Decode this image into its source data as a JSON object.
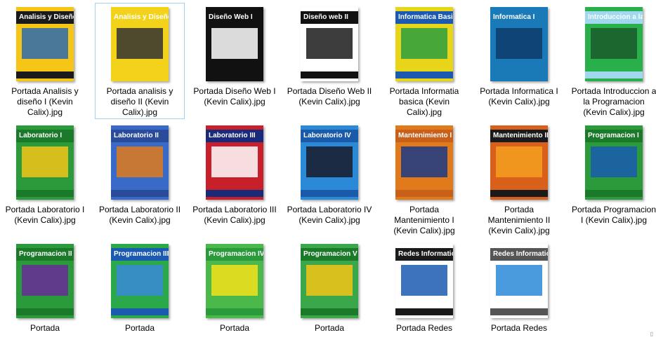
{
  "files": [
    {
      "label": "Portada Analisis y diseño I (Kevin Calix).jpg",
      "cover": "Analisis y Diseño I",
      "bg": "#f5c518",
      "band": "#1a1a1a",
      "accent": "#2a6ab0",
      "selected": false
    },
    {
      "label": "Portada analisis y diseño II (Kevin Calix).jpg",
      "cover": "Analisis y Diseño II",
      "bg": "#f2d21a",
      "band": "#f2d21a",
      "accent": "#333333",
      "selected": true
    },
    {
      "label": "Portada Diseño Web I (Kevin Calix).jpg",
      "cover": "Diseño Web I",
      "bg": "#111111",
      "band": "#111111",
      "accent": "#ffffff",
      "selected": false
    },
    {
      "label": "Portada Diseño Web II (Kevin Calix).jpg",
      "cover": "Diseño web II",
      "bg": "#ffffff",
      "band": "#111111",
      "accent": "#1a1a1a",
      "selected": false
    },
    {
      "label": "Portada Informatia basica (Kevin Calix).jpg",
      "cover": "Informatica Basica",
      "bg": "#e8d51a",
      "band": "#1a5ab0",
      "accent": "#2aa040",
      "selected": false
    },
    {
      "label": "Portada Informatica I (Kevin Calix).jpg",
      "cover": "Informatica I",
      "bg": "#1a7ab8",
      "band": "#1a7ab8",
      "accent": "#0d3c6a",
      "selected": false
    },
    {
      "label": "Portada Introduccion a la Programacion (Kevin Calix).jpg",
      "cover": "Introduccion a la Programacion",
      "bg": "#2ab04a",
      "band": "#9fd8ef",
      "accent": "#1a5a2a",
      "selected": false
    },
    {
      "label": "Portada Laboratorio I (Kevin Calix).jpg",
      "cover": "Laboratorio I",
      "bg": "#2a9a3a",
      "band": "#1a7a2a",
      "accent": "#f5c518",
      "selected": false
    },
    {
      "label": "Portada Laboratorio II (Kevin Calix).jpg",
      "cover": "Laboratorio II",
      "bg": "#3a6ac8",
      "band": "#2a4a9a",
      "accent": "#e07a1a",
      "selected": false
    },
    {
      "label": "Portada Laboratorio III (Kevin Calix).jpg",
      "cover": "Laboratorio III",
      "bg": "#c8202a",
      "band": "#1a2a7a",
      "accent": "#ffffff",
      "selected": false
    },
    {
      "label": "Portada Laboratorio IV  (Kevin Calix).jpg",
      "cover": "Laboratorio IV",
      "bg": "#2a8ad8",
      "band": "#1a5aa8",
      "accent": "#1a1a2a",
      "selected": false
    },
    {
      "label": "Portada Mantenimiento I (Kevin Calix).jpg",
      "cover": "Mantenimiento I",
      "bg": "#e07a1a",
      "band": "#c8601a",
      "accent": "#1a3a8a",
      "selected": false
    },
    {
      "label": "Portada Mantenimiento II (Kevin Calix).jpg",
      "cover": "Mantenimiento II",
      "bg": "#d8601a",
      "band": "#1a1a1a",
      "accent": "#f5a020",
      "selected": false
    },
    {
      "label": "Portada Programacion I (Kevin Calix).jpg",
      "cover": "Programacion I",
      "bg": "#2a9a3a",
      "band": "#1a7a2a",
      "accent": "#1a5ab0",
      "selected": false
    },
    {
      "label": "Portada",
      "cover": "Programacion II",
      "bg": "#2a9a3a",
      "band": "#1a7a2a",
      "accent": "#6a2a9a",
      "selected": false
    },
    {
      "label": "Portada",
      "cover": "Programacion III",
      "bg": "#2aa84a",
      "band": "#1a5ab0",
      "accent": "#3a8ad8",
      "selected": false
    },
    {
      "label": "Portada",
      "cover": "Programacion IV",
      "bg": "#4ab84a",
      "band": "#2a9a3a",
      "accent": "#f5e01a",
      "selected": false
    },
    {
      "label": "Portada",
      "cover": "Programacion V",
      "bg": "#3aa84a",
      "band": "#1a7a2a",
      "accent": "#f5c518",
      "selected": false
    },
    {
      "label": "Portada Redes",
      "cover": "Redes Informaticas I",
      "bg": "#ffffff",
      "band": "#1a1a1a",
      "accent": "#1a5ab0",
      "selected": false
    },
    {
      "label": "Portada Redes",
      "cover": "Redes Informaticas II",
      "bg": "#ffffff",
      "band": "#555555",
      "accent": "#2a8ad8",
      "selected": false
    }
  ],
  "corner_glyph": "▯"
}
